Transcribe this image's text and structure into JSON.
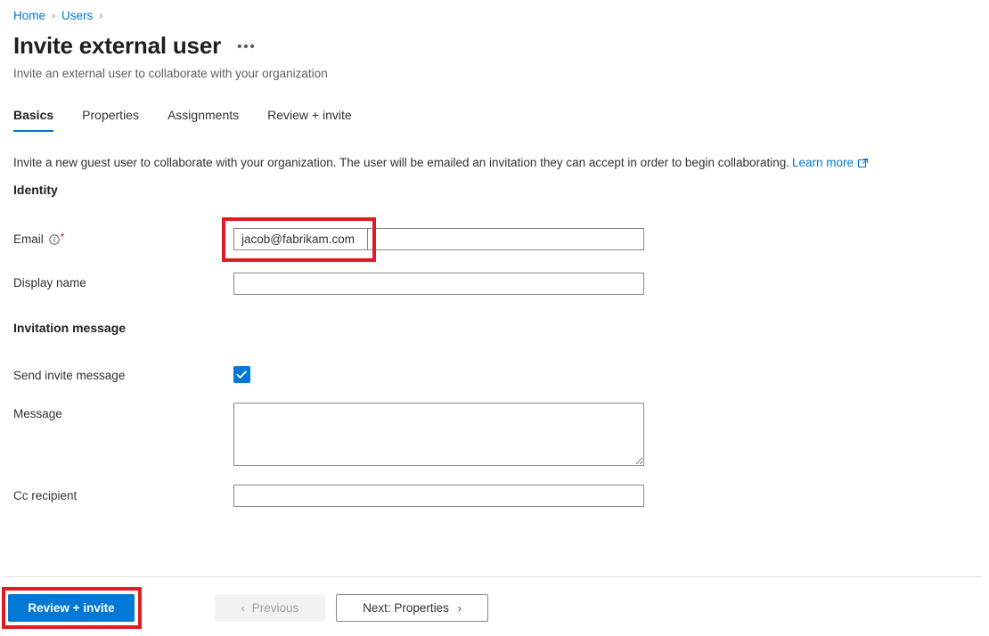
{
  "breadcrumb": {
    "items": [
      {
        "label": "Home"
      },
      {
        "label": "Users"
      }
    ],
    "separator": "›"
  },
  "header": {
    "title": "Invite external user",
    "more_label": "•••",
    "subtitle": "Invite an external user to collaborate with your organization"
  },
  "tabs": [
    {
      "label": "Basics",
      "active": true
    },
    {
      "label": "Properties",
      "active": false
    },
    {
      "label": "Assignments",
      "active": false
    },
    {
      "label": "Review + invite",
      "active": false
    }
  ],
  "intro": {
    "text": "Invite a new guest user to collaborate with your organization. The user will be emailed an invitation they can accept in order to begin collaborating.",
    "link_label": "Learn more",
    "link_icon": "external-link-icon"
  },
  "sections": {
    "identity": {
      "heading": "Identity",
      "email": {
        "label": "Email",
        "info_icon": "info-circle-icon",
        "required_marker": "*",
        "value": "jacob@fabrikam.com",
        "placeholder": ""
      },
      "display_name": {
        "label": "Display name",
        "value": "",
        "placeholder": ""
      }
    },
    "invitation_message": {
      "heading": "Invitation message",
      "send_invite": {
        "label": "Send invite message",
        "checked": true,
        "icon": "checkmark-icon"
      },
      "message": {
        "label": "Message",
        "value": "",
        "placeholder": ""
      },
      "cc_recipient": {
        "label": "Cc recipient",
        "value": "",
        "placeholder": ""
      }
    }
  },
  "footer": {
    "review_invite_label": "Review + invite",
    "previous_label": "Previous",
    "previous_icon": "chevron-left-icon",
    "next_label": "Next: Properties",
    "next_icon": "chevron-right-icon"
  },
  "annotations": {
    "highlight_color": "#e01b24",
    "targets": [
      "email-input",
      "review-invite-button"
    ]
  },
  "colors": {
    "accent": "#0078d4",
    "link": "#0078d4",
    "required": "#a4262c",
    "border": "#8a8886",
    "text": "#323130",
    "muted": "#605e5c"
  }
}
